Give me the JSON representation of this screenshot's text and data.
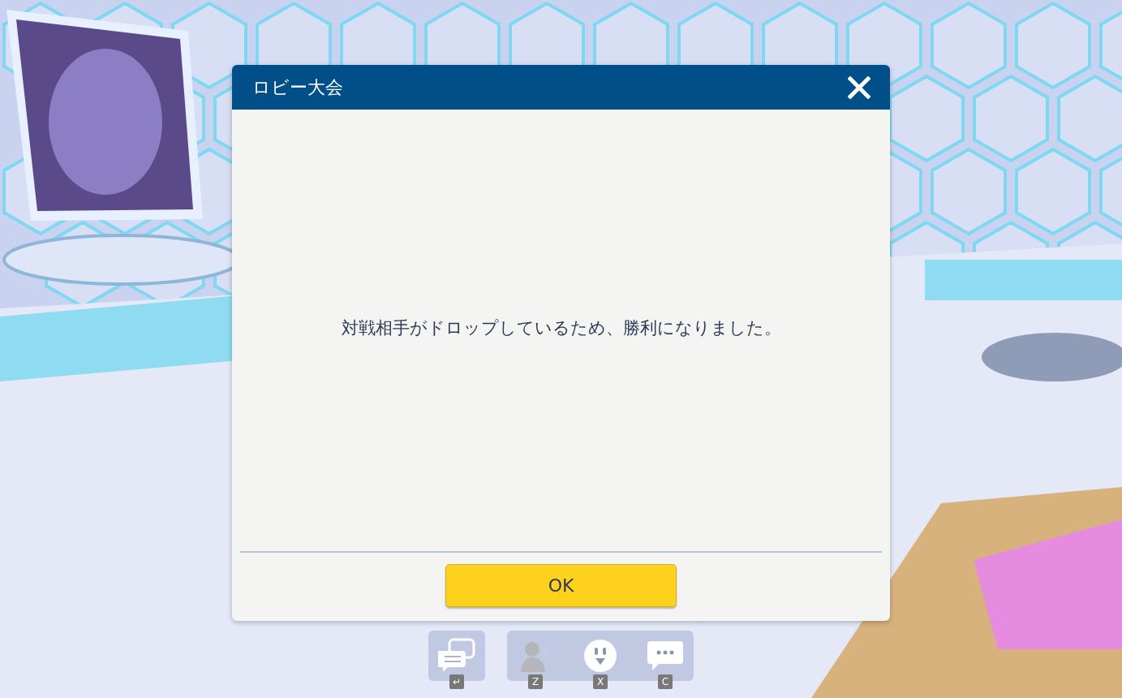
{
  "dialog": {
    "title": "ロビー大会",
    "message": "対戦相手がドロップしているため、勝利になりました。",
    "buttons": [
      "OK"
    ]
  },
  "toolbar": {
    "groups": [
      {
        "buttons": [
          {
            "kind": "chat-log",
            "key": "↵",
            "disabled": false
          }
        ]
      },
      {
        "buttons": [
          {
            "kind": "figure",
            "key": "Z",
            "disabled": true
          },
          {
            "kind": "emote",
            "key": "X",
            "disabled": false
          },
          {
            "kind": "speech",
            "key": "C",
            "disabled": false
          }
        ]
      }
    ]
  }
}
